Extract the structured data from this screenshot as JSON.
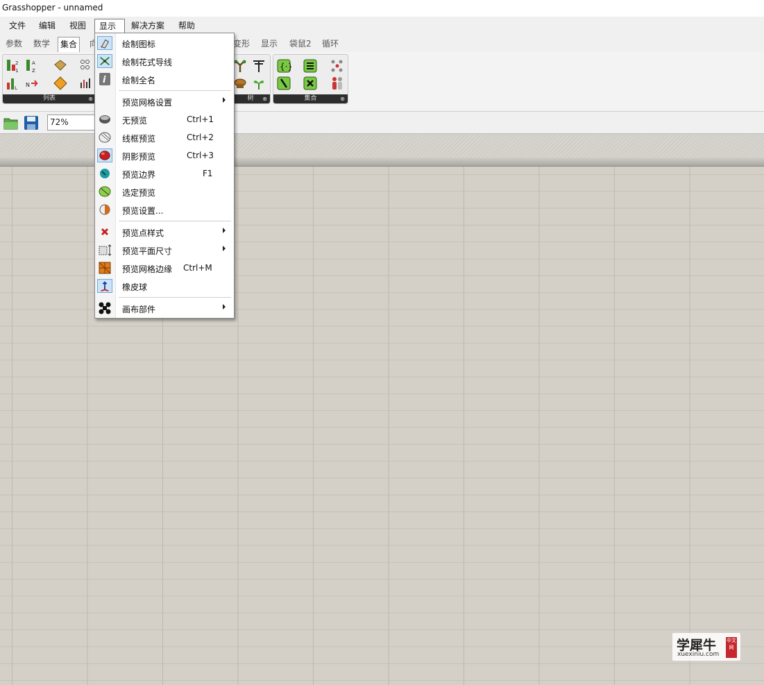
{
  "window": {
    "title": "Grasshopper - unnamed"
  },
  "menubar": [
    {
      "label": "文件"
    },
    {
      "label": "编辑"
    },
    {
      "label": "视图"
    },
    {
      "label": "显示"
    },
    {
      "label": "解决方案"
    },
    {
      "label": "帮助"
    }
  ],
  "tabs": [
    {
      "label": "参数"
    },
    {
      "label": "数学"
    },
    {
      "label": "集合"
    },
    {
      "label": "向"
    },
    {
      "label": "变形"
    },
    {
      "label": "显示"
    },
    {
      "label": "袋鼠2"
    },
    {
      "label": "循环"
    }
  ],
  "ribbon_panels": {
    "list": "列表",
    "tree": "树",
    "sets": "集合"
  },
  "toolbar": {
    "zoom": "72%"
  },
  "display_menu": {
    "items": [
      {
        "label": "绘制图标",
        "shortcut": ""
      },
      {
        "label": "绘制花式导线",
        "shortcut": ""
      },
      {
        "label": "绘制全名",
        "shortcut": ""
      },
      {
        "label": "预览网格设置",
        "shortcut": ""
      },
      {
        "label": "无预览",
        "shortcut": "Ctrl+1"
      },
      {
        "label": "线框预览",
        "shortcut": "Ctrl+2"
      },
      {
        "label": "阴影预览",
        "shortcut": "Ctrl+3"
      },
      {
        "label": "预览边界",
        "shortcut": "F1"
      },
      {
        "label": "选定预览",
        "shortcut": ""
      },
      {
        "label": "预览设置...",
        "shortcut": ""
      },
      {
        "label": "预览点样式",
        "shortcut": ""
      },
      {
        "label": "预览平面尺寸",
        "shortcut": ""
      },
      {
        "label": "预览网格边缘",
        "shortcut": "Ctrl+M"
      },
      {
        "label": "橡皮球",
        "shortcut": ""
      },
      {
        "label": "画布部件",
        "shortcut": ""
      }
    ]
  },
  "watermark": {
    "title": "学犀牛",
    "site": "xuexiniu.com",
    "seal": "中文网"
  },
  "colors": {
    "canvas": "#d4d0c8",
    "menu_highlight": "#cde4f7",
    "panel_label": "#2d2d2d"
  }
}
